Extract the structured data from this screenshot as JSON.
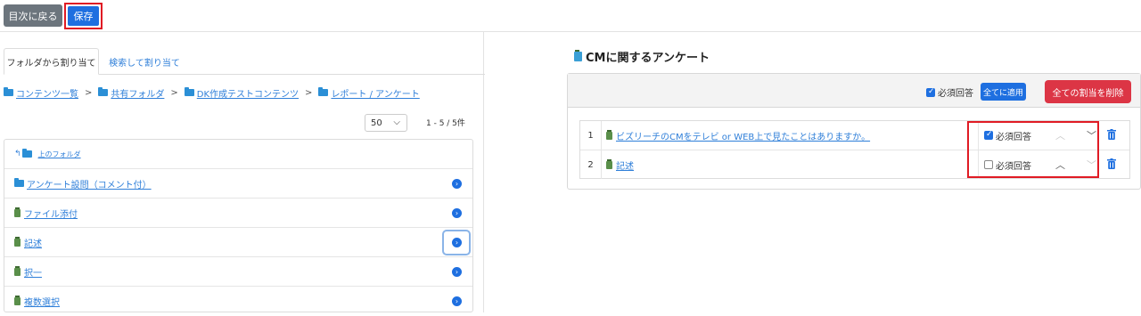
{
  "toolbar": {
    "back_label": "目次に戻る",
    "save_label": "保存"
  },
  "left": {
    "tabs": [
      "フォルダから割り当て",
      "検索して割り当て"
    ],
    "breadcrumb": [
      "コンテンツ一覧",
      "共有フォルダ",
      "DK作成テストコンテンツ",
      "レポート / アンケート"
    ],
    "breadcrumb_sep": ">",
    "per_page": "50",
    "count": "1 - 5 / 5件",
    "up_folder": "上のフォルダ",
    "items": [
      {
        "label": "アンケート設問（コメント付）",
        "icon": "folder-icon"
      },
      {
        "label": "ファイル添付",
        "icon": "clipboard-icon"
      },
      {
        "label": "記述",
        "icon": "clipboard-icon"
      },
      {
        "label": "択一",
        "icon": "clipboard-icon"
      },
      {
        "label": "複数選択",
        "icon": "clipboard-icon"
      }
    ]
  },
  "right": {
    "title": "CMに関するアンケート",
    "required_label": "必須回答",
    "apply_all_label": "全てに適用",
    "delete_all_label": "全ての割当を削除",
    "questions": [
      {
        "num": "1",
        "text": "ビズリーチのCMをテレビ or WEB上で見たことはありますか。",
        "required": true
      },
      {
        "num": "2",
        "text": "記述",
        "required": false
      }
    ]
  },
  "colors": {
    "primary": "#1e6fe0",
    "danger": "#dc3545",
    "secondary": "#6c757d",
    "highlight": "#e01b24"
  }
}
